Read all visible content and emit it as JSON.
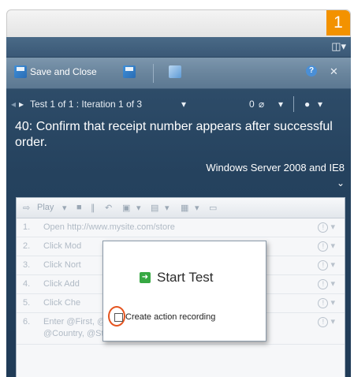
{
  "step_badge": "1",
  "toolbar": {
    "save_close_label": "Save and Close",
    "help_label": "?",
    "close_label": "✕"
  },
  "nav": {
    "test_iteration": "Test 1 of 1 : Iteration 1 of 3",
    "attachment_count": "0"
  },
  "test": {
    "title": "40: Confirm that receipt number appears after successful order.",
    "configuration": "Windows Server 2008 and IE8"
  },
  "steps_toolbar": {
    "play_label": "Play"
  },
  "steps": [
    {
      "num": "1.",
      "text": "Open http://www.mysite.com/store"
    },
    {
      "num": "2.",
      "text": "Click Mod"
    },
    {
      "num": "3.",
      "text": "Click Nort"
    },
    {
      "num": "4.",
      "text": "Click Add"
    },
    {
      "num": "5.",
      "text": "Click Che"
    },
    {
      "num": "6.",
      "text": "Enter @First, @Last, @Email, @Address, @City,",
      "text2": "@Country, @State, @PostalCode"
    }
  ],
  "popup": {
    "start_label": "Start Test",
    "record_label": "Create action recording"
  },
  "colors": {
    "accent": "#f39200",
    "panel": "#25425e",
    "start": "#37a843",
    "highlight": "#e5541f"
  }
}
